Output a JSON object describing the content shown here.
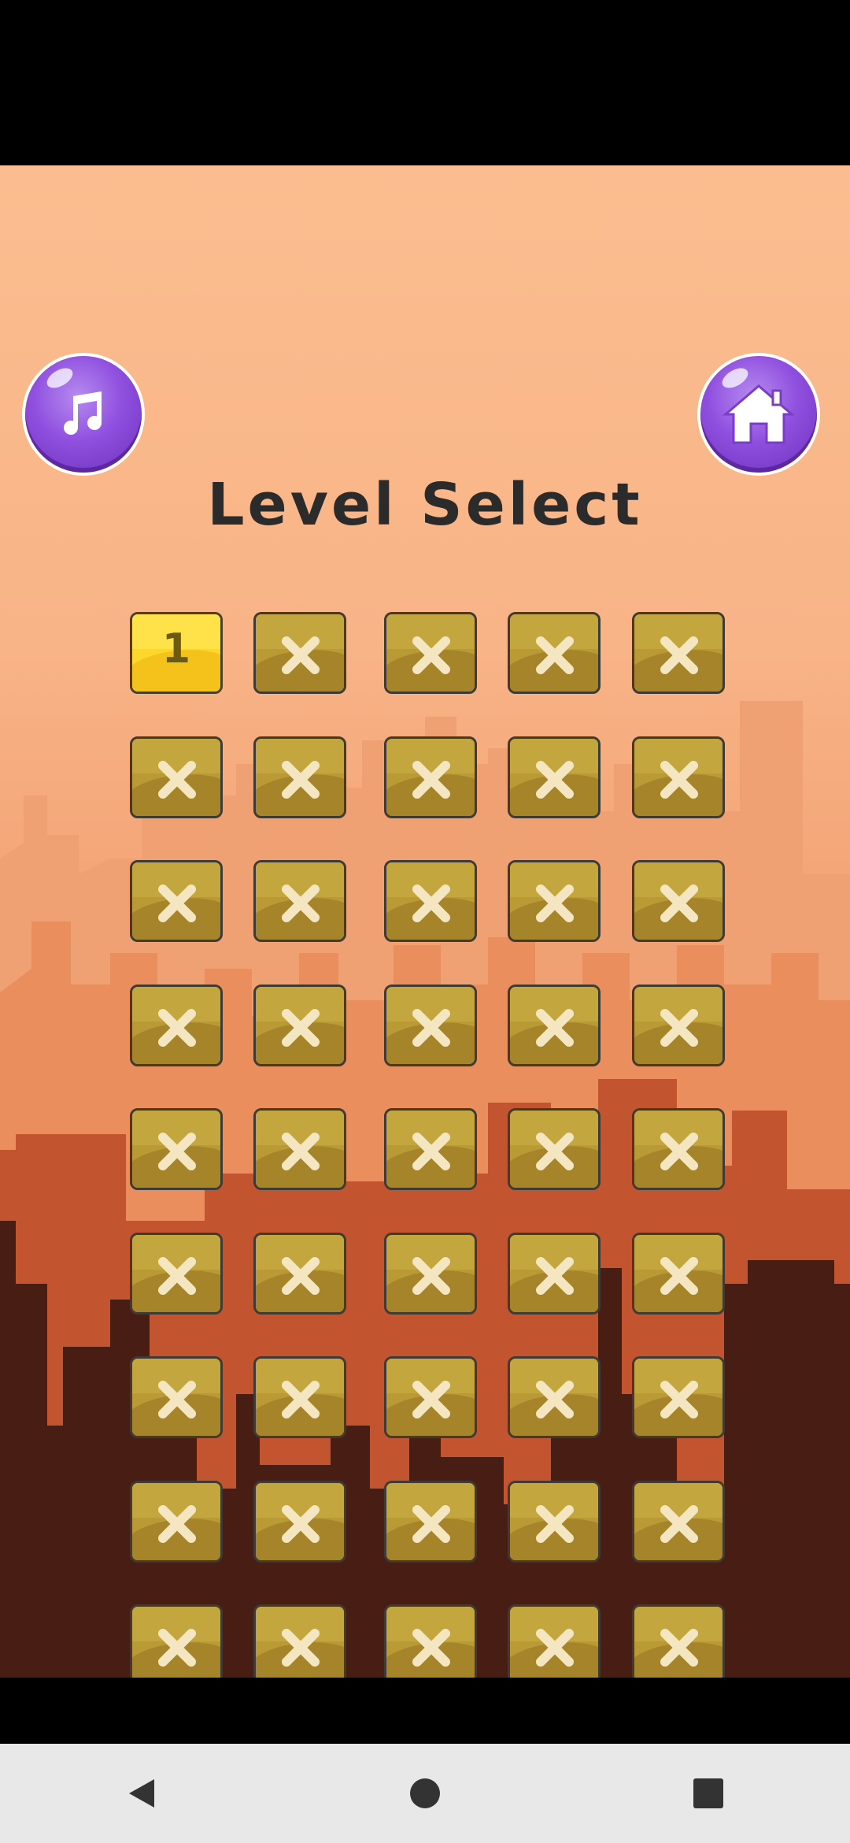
{
  "header": {
    "title": "Level Select",
    "music_button_icon": "music-note-icon",
    "home_button_icon": "home-icon"
  },
  "levels": [
    {
      "label": "1",
      "locked": false
    },
    {
      "label": "",
      "locked": true
    },
    {
      "label": "",
      "locked": true
    },
    {
      "label": "",
      "locked": true
    },
    {
      "label": "",
      "locked": true
    },
    {
      "label": "",
      "locked": true
    },
    {
      "label": "",
      "locked": true
    },
    {
      "label": "",
      "locked": true
    },
    {
      "label": "",
      "locked": true
    },
    {
      "label": "",
      "locked": true
    },
    {
      "label": "",
      "locked": true
    },
    {
      "label": "",
      "locked": true
    },
    {
      "label": "",
      "locked": true
    },
    {
      "label": "",
      "locked": true
    },
    {
      "label": "",
      "locked": true
    },
    {
      "label": "",
      "locked": true
    },
    {
      "label": "",
      "locked": true
    },
    {
      "label": "",
      "locked": true
    },
    {
      "label": "",
      "locked": true
    },
    {
      "label": "",
      "locked": true
    },
    {
      "label": "",
      "locked": true
    },
    {
      "label": "",
      "locked": true
    },
    {
      "label": "",
      "locked": true
    },
    {
      "label": "",
      "locked": true
    },
    {
      "label": "",
      "locked": true
    },
    {
      "label": "",
      "locked": true
    },
    {
      "label": "",
      "locked": true
    },
    {
      "label": "",
      "locked": true
    },
    {
      "label": "",
      "locked": true
    },
    {
      "label": "",
      "locked": true
    },
    {
      "label": "",
      "locked": true
    },
    {
      "label": "",
      "locked": true
    },
    {
      "label": "",
      "locked": true
    },
    {
      "label": "",
      "locked": true
    },
    {
      "label": "",
      "locked": true
    },
    {
      "label": "",
      "locked": true
    },
    {
      "label": "",
      "locked": true
    },
    {
      "label": "",
      "locked": true
    },
    {
      "label": "",
      "locked": true
    },
    {
      "label": "",
      "locked": true
    },
    {
      "label": "",
      "locked": true
    },
    {
      "label": "",
      "locked": true
    },
    {
      "label": "",
      "locked": true
    },
    {
      "label": "",
      "locked": true
    },
    {
      "label": "",
      "locked": true
    }
  ],
  "navbar": {
    "back_icon": "back-triangle-icon",
    "home_icon": "home-circle-icon",
    "recents_icon": "recents-square-icon"
  },
  "colors": {
    "locked_tile": "#b99a34",
    "unlocked_tile": "#fed72c",
    "button_purple": "#9050df"
  }
}
